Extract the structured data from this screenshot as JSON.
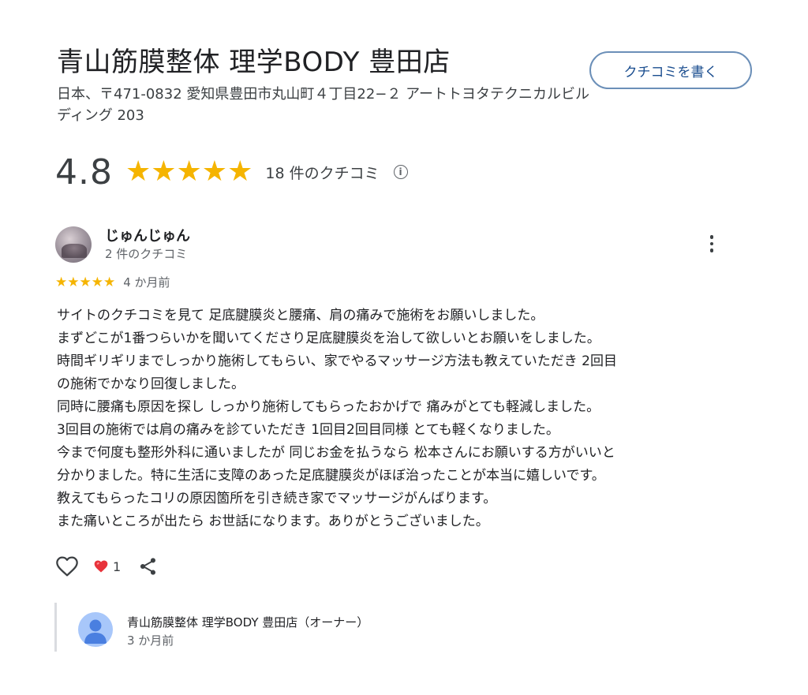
{
  "business": {
    "name": "青山筋膜整体 理学BODY 豊田店",
    "address": "日本、〒471-0832 愛知県豊田市丸山町４丁目22−２ アートトヨタテクニカルビルディング 203"
  },
  "actions": {
    "write_review_label": "クチコミを書く"
  },
  "rating": {
    "value": "4.8",
    "stars": "★★★★★",
    "star_count": 5,
    "review_count_label": "18 件のクチコミ",
    "info_glyph": "i"
  },
  "review": {
    "reviewer_name": "じゅんじゅん",
    "reviewer_reviews": "2 件のクチコミ",
    "stars": "★★★★★",
    "star_count": 5,
    "time": "4 か月前",
    "lines": [
      "サイトのクチコミを見て 足底腱膜炎と腰痛、肩の痛みで施術をお願いしました。",
      "まずどこが1番つらいかを聞いてくださり足底腱膜炎を治して欲しいとお願いをしました。",
      "時間ギリギリまでしっかり施術してもらい、家でやるマッサージ方法も教えていただき 2回目",
      "の施術でかなり回復しました。",
      "同時に腰痛も原因を探し しっかり施術してもらったおかげで 痛みがとても軽減しました。",
      "3回目の施術では肩の痛みを診ていただき 1回目2回目同様 とても軽くなりました。",
      "今まで何度も整形外科に通いましたが 同じお金を払うなら 松本さんにお願いする方がいいと",
      "分かりました。特に生活に支障のあった足底腱膜炎がほぼ治ったことが本当に嬉しいです。",
      "教えてもらったコリの原因箇所を引き続き家でマッサージがんばります。",
      "また痛いところが出たら お世話になります。ありがとうございました。"
    ],
    "reaction_count": "1",
    "icons": {
      "like": "heart-outline-icon",
      "reaction": "red-heart-icon",
      "share": "share-icon",
      "more": "more-vert-icon"
    }
  },
  "owner_reply": {
    "name": "青山筋膜整体 理学BODY 豊田店（オーナー）",
    "time": "3 か月前",
    "avatar_icon": "person-icon"
  },
  "colors": {
    "star": "#f5b400",
    "button_border": "#6b8fb8",
    "button_text": "#1a4d8f",
    "reaction_heart": "#e8333b",
    "owner_avatar": "#a8c7fa"
  }
}
